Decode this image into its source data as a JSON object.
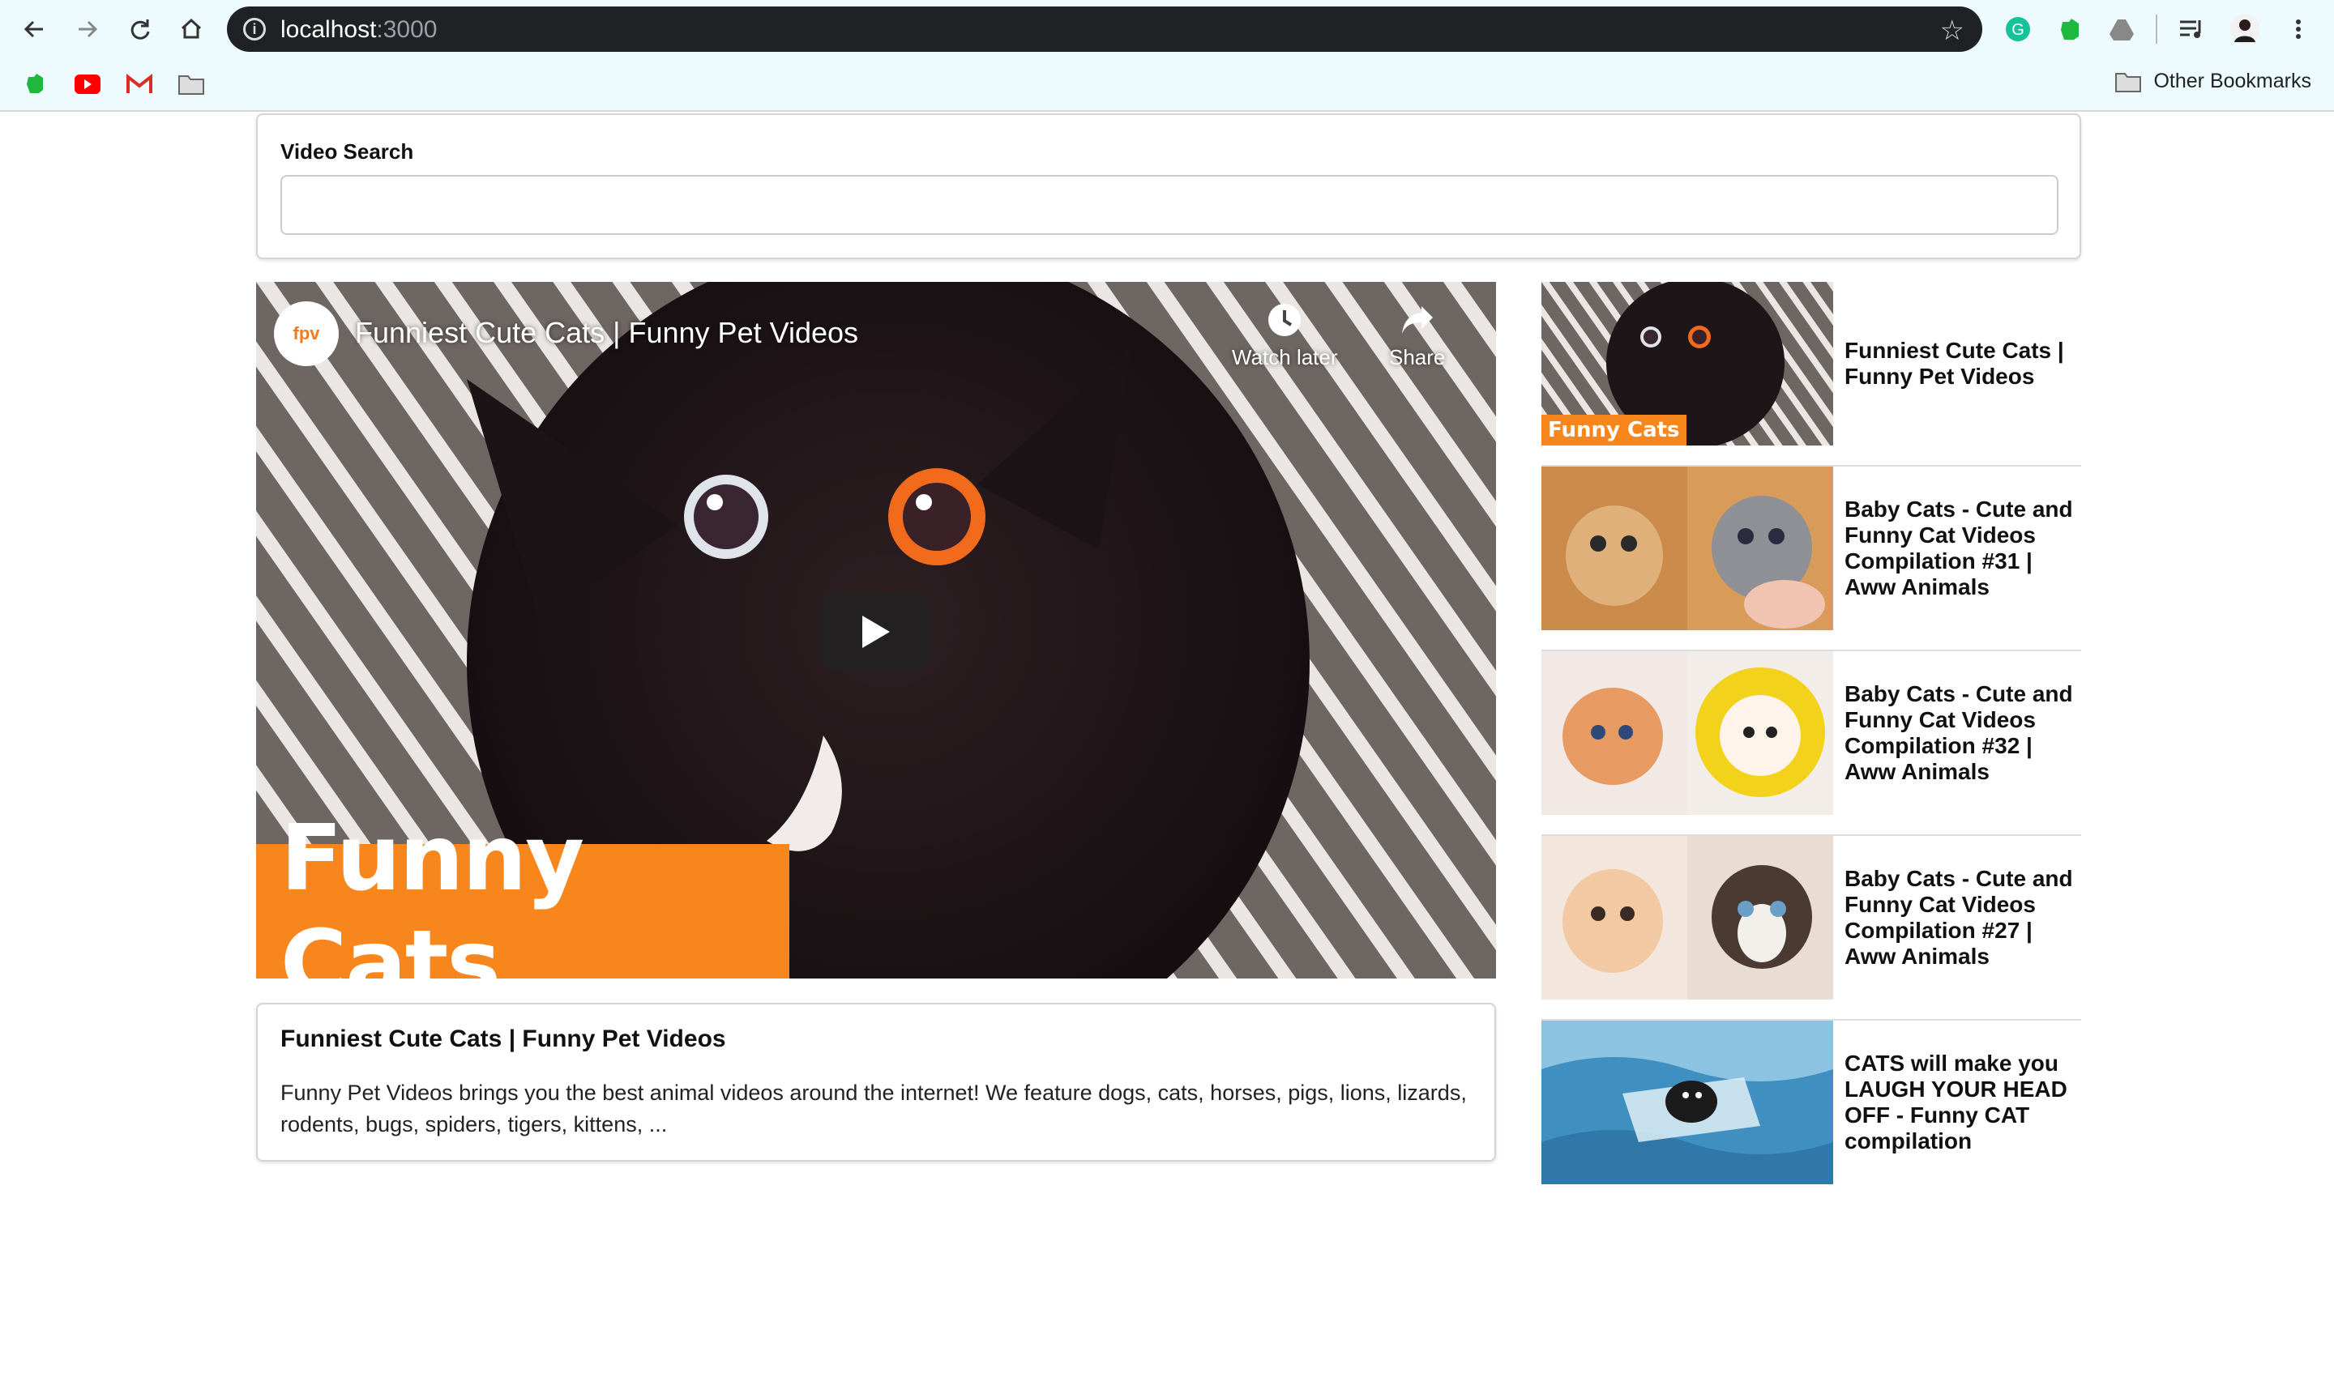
{
  "browser": {
    "url_host": "localhost",
    "url_port": ":3000",
    "bookmarks_other": "Other Bookmarks",
    "icons": [
      "back-arrow-icon",
      "forward-arrow-icon",
      "reload-icon",
      "home-icon",
      "info-icon",
      "star-icon",
      "grammarly-icon",
      "evernote-icon",
      "drive-icon",
      "media-icon",
      "avatar",
      "menu-icon"
    ]
  },
  "search": {
    "label": "Video Search",
    "value": ""
  },
  "player": {
    "title": "Funniest Cute Cats | Funny Pet Videos",
    "logo_text": "fpv",
    "watch_later": "Watch later",
    "share": "Share",
    "brand": "Funny Cats"
  },
  "detail": {
    "title": "Funniest Cute Cats | Funny Pet Videos",
    "description": "Funny Pet Videos brings you the best animal videos around the internet! We feature dogs, cats, horses, pigs, lions, lizards, rodents, bugs, spiders, tigers, kittens, ..."
  },
  "video_list": [
    {
      "title": "Funniest Cute Cats | Funny Pet Videos",
      "thumb_tag": "Funny Cats"
    },
    {
      "title": "Baby Cats - Cute and Funny Cat Videos Compilation #31 | Aww Animals"
    },
    {
      "title": "Baby Cats - Cute and Funny Cat Videos Compilation #32 | Aww Animals"
    },
    {
      "title": "Baby Cats - Cute and Funny Cat Videos Compilation #27 | Aww Animals"
    },
    {
      "title": "CATS will make you LAUGH YOUR HEAD OFF - Funny CAT compilation"
    }
  ],
  "colors": {
    "accent": "#f7861c",
    "chrome_bg": "#edfbff",
    "urlbar": "#202124"
  }
}
